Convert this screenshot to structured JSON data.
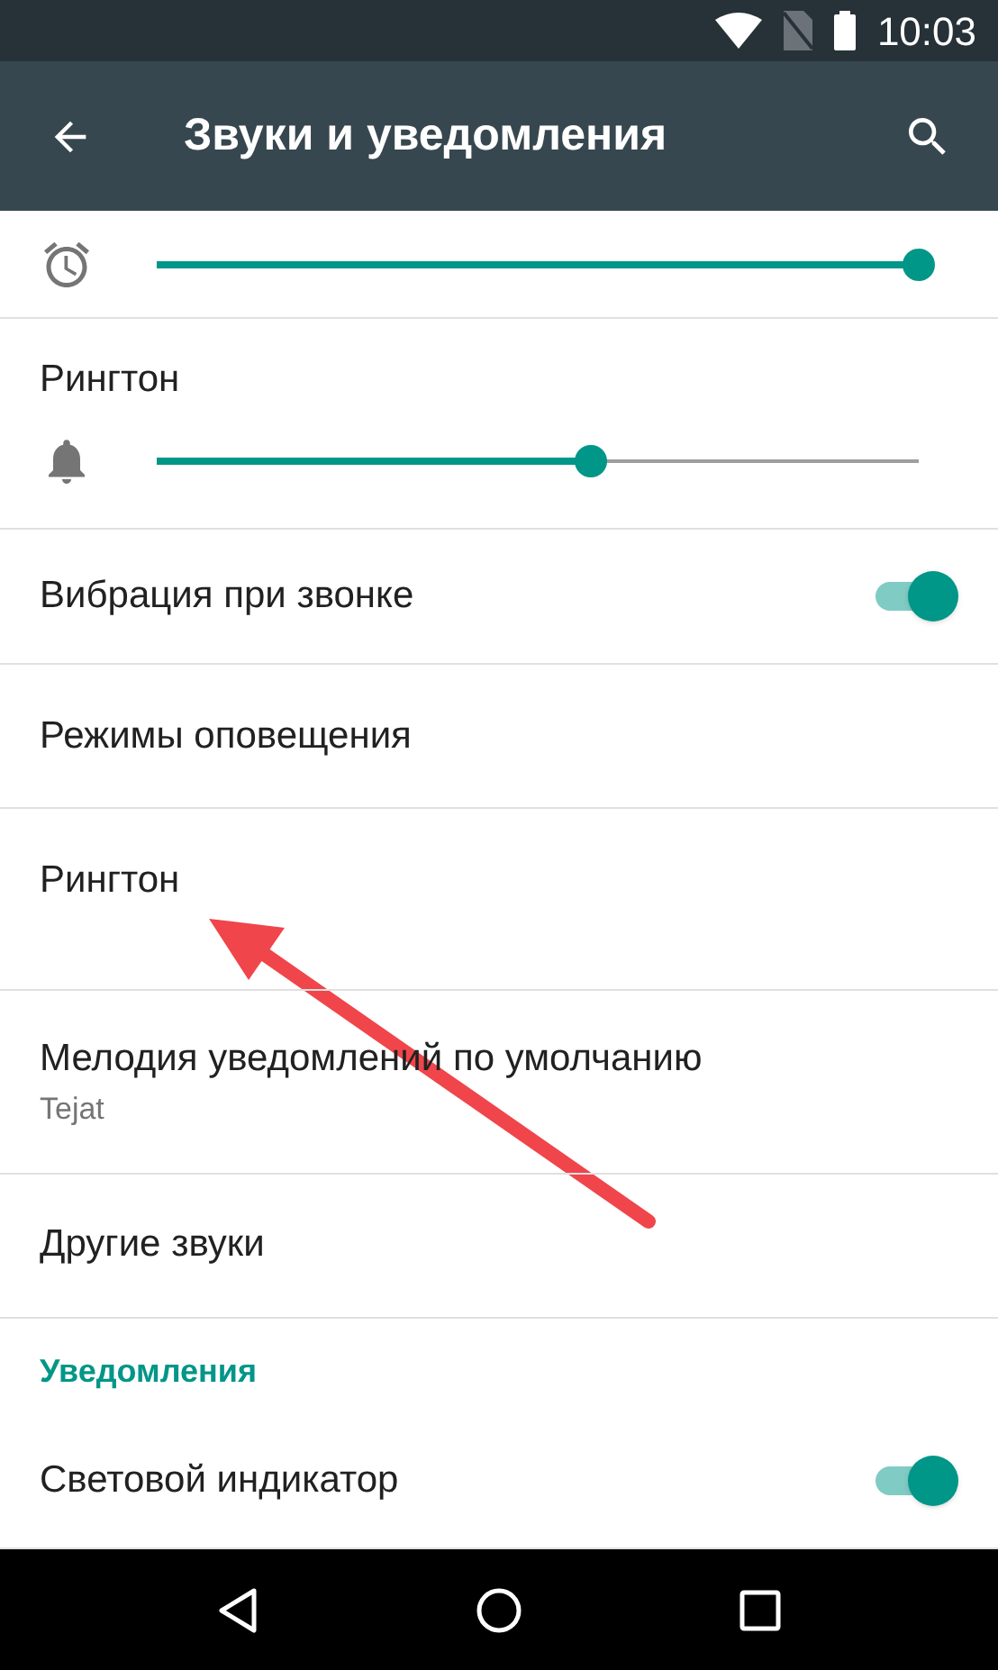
{
  "status_bar": {
    "time": "10:03"
  },
  "toolbar": {
    "title": "Звуки и уведомления"
  },
  "sliders": [
    {
      "kind": "alarm",
      "level": 1.0
    },
    {
      "kind": "ringer",
      "label": "Рингтон",
      "level": 0.57
    }
  ],
  "items": [
    {
      "kind": "toggle",
      "title": "Вибрация при звонке",
      "on": true
    },
    {
      "kind": "plain",
      "title": "Режимы оповещения"
    },
    {
      "kind": "tall",
      "title": "Рингтон"
    },
    {
      "kind": "plain",
      "title": "Мелодия уведомлений по умолчанию",
      "summary": "Tejat"
    },
    {
      "kind": "plain",
      "title": "Другие звуки"
    },
    {
      "kind": "header",
      "title": "Уведомления"
    },
    {
      "kind": "toggle",
      "title": "Световой индикатор",
      "on": true
    }
  ]
}
